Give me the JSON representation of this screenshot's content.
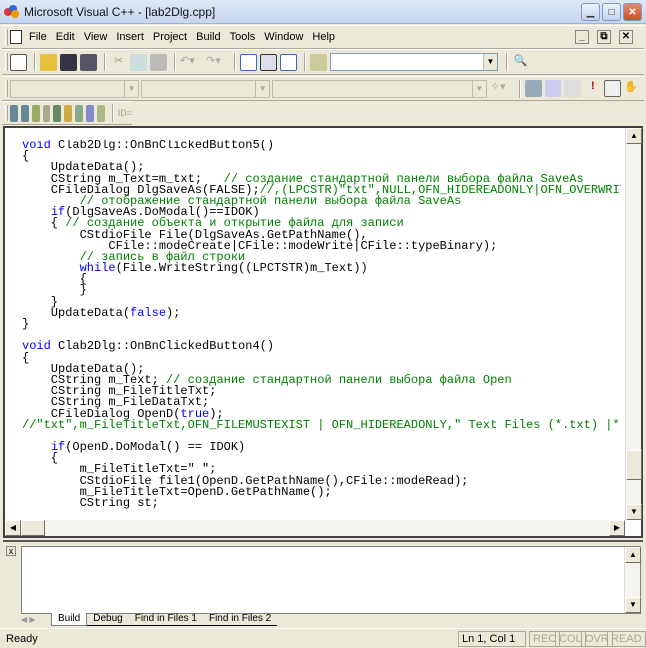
{
  "window": {
    "title": "Microsoft Visual C++ - [lab2Dlg.cpp]"
  },
  "menu": [
    "File",
    "Edit",
    "View",
    "Insert",
    "Project",
    "Build",
    "Tools",
    "Window",
    "Help"
  ],
  "toolbar": {
    "find_value": "",
    "id_label": "ID="
  },
  "code": [
    [
      [
        "kw",
        "void"
      ],
      [
        "tx",
        " Clab2Dlg::OnBnClickedButton5()"
      ]
    ],
    [
      [
        "tx",
        "{"
      ]
    ],
    [
      [
        "tx",
        "    UpdateData();"
      ]
    ],
    [
      [
        "tx",
        "    CString m_Text=m_txt;   "
      ],
      [
        "cm",
        "// создание стандартной панели выбора файла SaveAs"
      ]
    ],
    [
      [
        "tx",
        "    CFileDialog DlgSaveAs(FALSE);"
      ],
      [
        "cm",
        "//,(LPCSTR)\"txt\",NULL,OFN_HIDEREADONLY|OFN_OVERWRITEPROMPT"
      ]
    ],
    [
      [
        "cm",
        "        // отображение стандартной панели выбора файла SaveAs"
      ]
    ],
    [
      [
        "tx",
        "    "
      ],
      [
        "kw",
        "if"
      ],
      [
        "tx",
        "(DlgSaveAs.DoModal()==IDOK)"
      ]
    ],
    [
      [
        "tx",
        "    { "
      ],
      [
        "cm",
        "// создание объекта и открытие файла для записи"
      ]
    ],
    [
      [
        "tx",
        "        CStdioFile File(DlgSaveAs.GetPathName(),"
      ]
    ],
    [
      [
        "tx",
        "            CFile::modeCreate|CFile::modeWrite|CFile::typeBinary);"
      ]
    ],
    [
      [
        "cm",
        "        // запись в файл строки"
      ]
    ],
    [
      [
        "tx",
        "        "
      ],
      [
        "kw",
        "while"
      ],
      [
        "tx",
        "(File.WriteString((LPCTSTR)m_Text))"
      ]
    ],
    [
      [
        "tx",
        "        {"
      ]
    ],
    [
      [
        "tx",
        "        }"
      ]
    ],
    [
      [
        "tx",
        "    }"
      ]
    ],
    [
      [
        "tx",
        "    UpdateData("
      ],
      [
        "kw",
        "false"
      ],
      [
        "tx",
        ");"
      ]
    ],
    [
      [
        "tx",
        "}"
      ]
    ],
    [
      [
        "tx",
        ""
      ]
    ],
    [
      [
        "kw",
        "void"
      ],
      [
        "tx",
        " Clab2Dlg::OnBnClickedButton4()"
      ]
    ],
    [
      [
        "tx",
        "{"
      ]
    ],
    [
      [
        "tx",
        "    UpdateData();"
      ]
    ],
    [
      [
        "tx",
        "    CString m_Text; "
      ],
      [
        "cm",
        "// создание стандартной панели выбора файла Open"
      ]
    ],
    [
      [
        "tx",
        "    CString m_FileTitleTxt;"
      ]
    ],
    [
      [
        "tx",
        "    CString m_FileDataTxt;"
      ]
    ],
    [
      [
        "tx",
        "    CFileDialog OpenD("
      ],
      [
        "kw",
        "true"
      ],
      [
        "tx",
        ");"
      ]
    ],
    [
      [
        "cm",
        "//\"txt\",m_FileTitleTxt,OFN_FILEMUSTEXIST | OFN_HIDEREADONLY,\" Text Files (*.txt) |*.txt"
      ]
    ],
    [
      [
        "tx",
        ""
      ]
    ],
    [
      [
        "tx",
        "    "
      ],
      [
        "kw",
        "if"
      ],
      [
        "tx",
        "(OpenD.DoModal() == IDOK)"
      ]
    ],
    [
      [
        "tx",
        "    {"
      ]
    ],
    [
      [
        "tx",
        "        m_FileTitleTxt=\" \";"
      ]
    ],
    [
      [
        "tx",
        "        CStdioFile file1(OpenD.GetPathName(),CFile::modeRead);"
      ]
    ],
    [
      [
        "tx",
        "        m_FileTitleTxt=OpenD.GetPathName();"
      ]
    ],
    [
      [
        "tx",
        "        CString st;"
      ]
    ]
  ],
  "output_tabs": [
    "Build",
    "Debug",
    "Find in Files 1",
    "Find in Files 2"
  ],
  "status": {
    "text": "Ready",
    "position": "Ln 1, Col 1",
    "indicators": [
      "REC",
      "COL",
      "OVR",
      "READ"
    ]
  },
  "colors": {
    "keyword": "#0000ff",
    "comment": "#008000"
  }
}
